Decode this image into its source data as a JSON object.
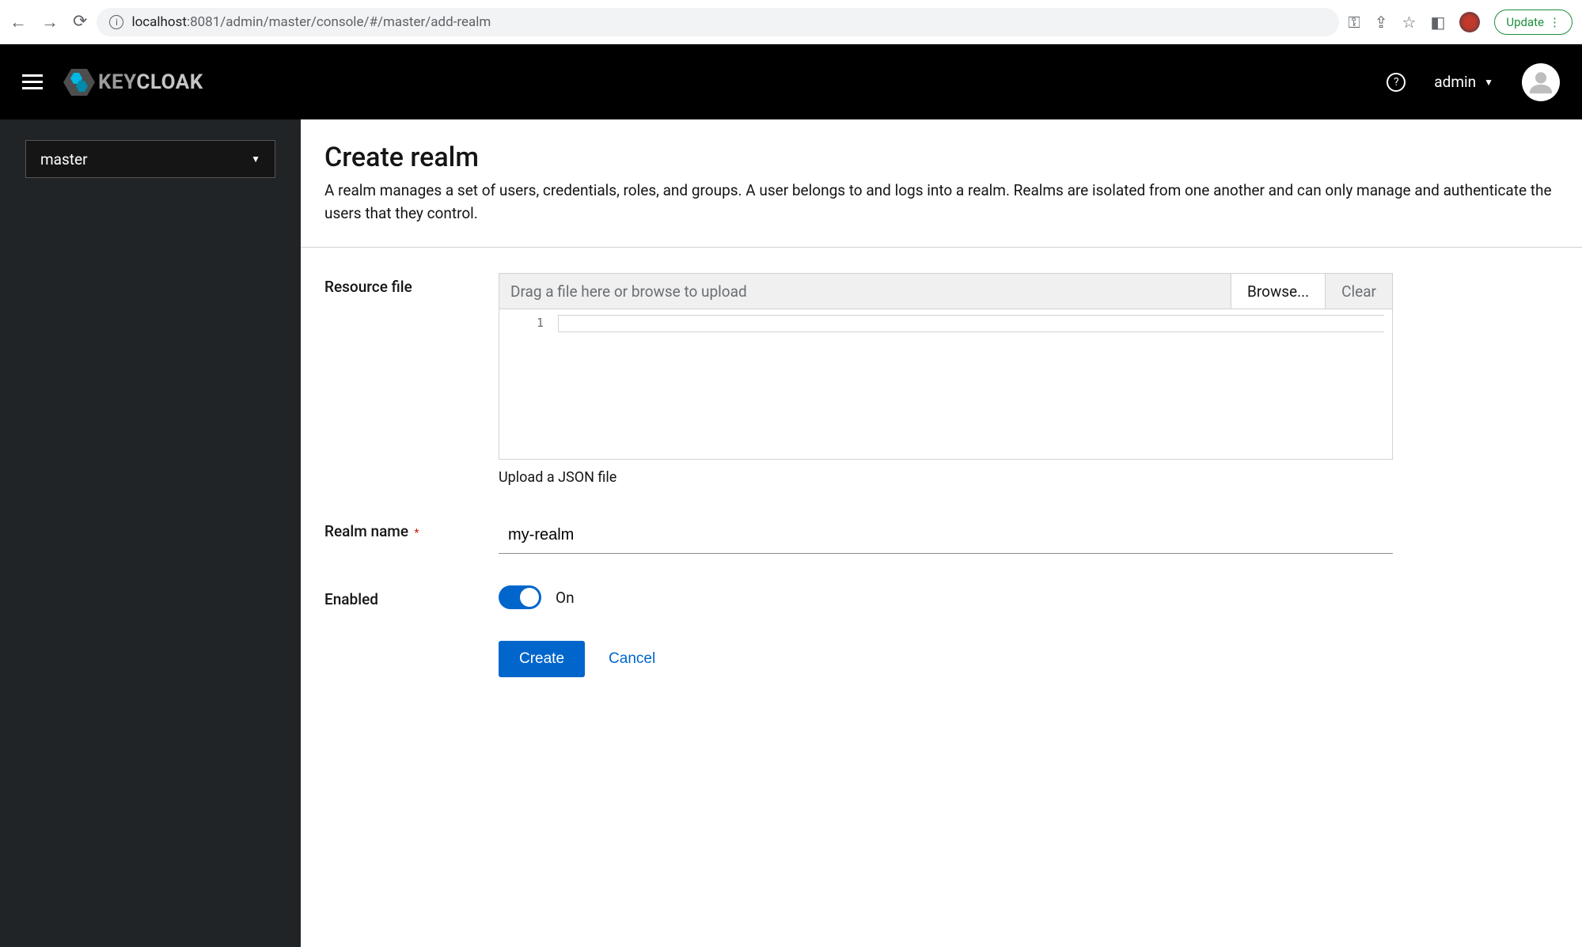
{
  "browser": {
    "url_host": "localhost",
    "url_port_path": ":8081/admin/master/console/#/master/add-realm",
    "update_label": "Update"
  },
  "header": {
    "logo_text_a": "KEY",
    "logo_text_b": "CLOAK",
    "username": "admin"
  },
  "sidebar": {
    "realm_selected": "master"
  },
  "page": {
    "title": "Create realm",
    "description": "A realm manages a set of users, credentials, roles, and groups. A user belongs to and logs into a realm. Realms are isolated from one another and can only manage and authenticate the users that they control."
  },
  "form": {
    "resource_file": {
      "label": "Resource file",
      "drop_placeholder": "Drag a file here or browse to upload",
      "browse_label": "Browse...",
      "clear_label": "Clear",
      "line_number": "1",
      "hint": "Upload a JSON file"
    },
    "realm_name": {
      "label": "Realm name",
      "value": "my-realm"
    },
    "enabled": {
      "label": "Enabled",
      "state_label": "On",
      "value": true
    },
    "actions": {
      "create": "Create",
      "cancel": "Cancel"
    }
  }
}
